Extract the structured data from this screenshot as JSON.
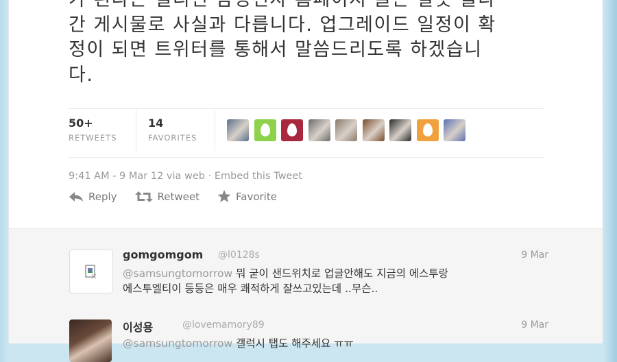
{
  "tweet": {
    "lines": [
      "가 된다는 필리핀 삼성전자 홈페이지 글은 잘못 올라",
      "간 게시물로 사실과 다릅니다. 업그레이드 일정이 확",
      "정이 되면 트위터를 통해서 말씀드리도록 하겠습니",
      "다."
    ],
    "retweets_count": "50+",
    "retweets_label": "RETWEETS",
    "favorites_count": "14",
    "favorites_label": "FAVORITES",
    "timestamp": "9:41 AM - 9 Mar 12 via web",
    "separator": "·",
    "embed_label": "Embed this Tweet",
    "actions": {
      "reply": "Reply",
      "retweet": "Retweet",
      "favorite": "Favorite"
    }
  },
  "favoriters": [
    {
      "icon": "user-photo-icon",
      "color": "#5a6f8c"
    },
    {
      "icon": "default-egg-icon",
      "color": "#8ed14a"
    },
    {
      "icon": "default-egg-icon",
      "color": "#a8283e"
    },
    {
      "icon": "user-photo-icon",
      "color": "#6b6b6b"
    },
    {
      "icon": "user-photo-icon",
      "color": "#8a7a6a"
    },
    {
      "icon": "user-photo-icon",
      "color": "#7a4a2a"
    },
    {
      "icon": "user-photo-icon",
      "color": "#2a2a2a"
    },
    {
      "icon": "default-egg-icon",
      "color": "#f0a03c"
    },
    {
      "icon": "user-photo-icon",
      "color": "#5b6fb5"
    }
  ],
  "replies": [
    {
      "name": "gomgomgom",
      "handle": "@l0128s",
      "time": "9 Mar",
      "mention": "@samsungtomorrow",
      "text_line1": " 뭐 굳이 샌드위치로 업글안해도 지금의 에스투랑",
      "text_line2": "에스투엘티이 등등은 매우 쾌적하게 잘쓰고있는데 ..무슨.."
    },
    {
      "name": "이성용",
      "handle": "@lovemamory89",
      "time": "9 Mar",
      "mention": "@samsungtomorrow",
      "text_line1": " 갤럭시 탭도 해주세요 ㅠㅠ"
    }
  ]
}
